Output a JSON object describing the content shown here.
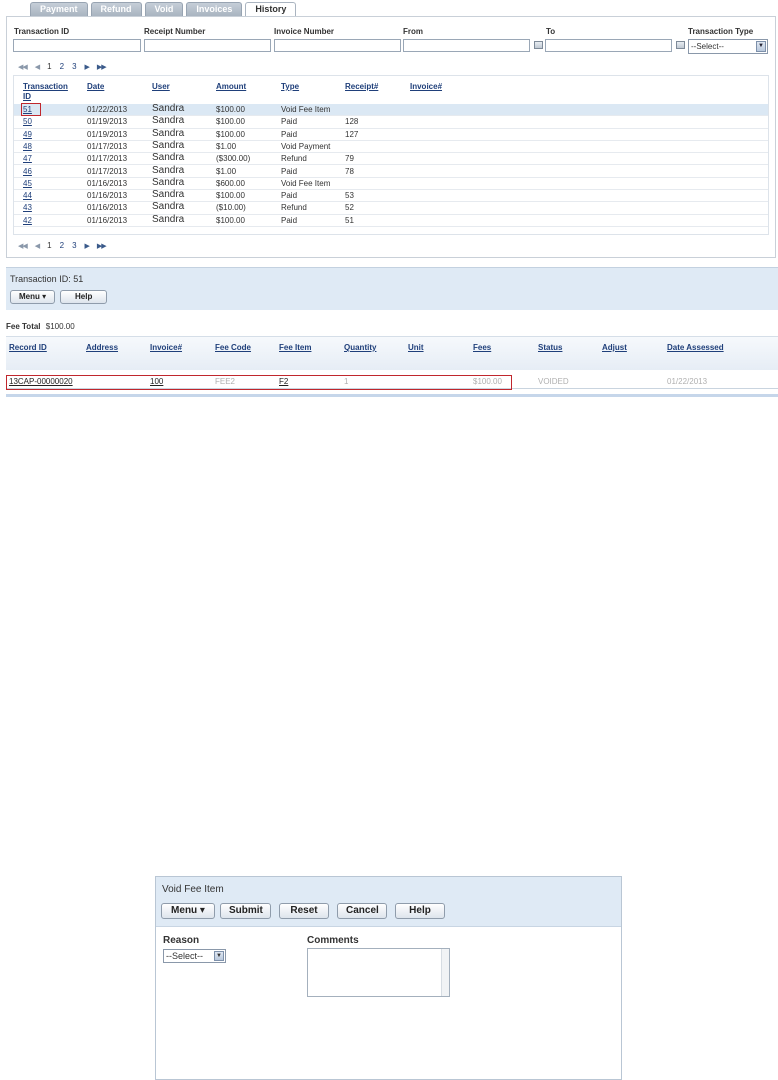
{
  "tabs": [
    {
      "label": "Payment"
    },
    {
      "label": "Refund"
    },
    {
      "label": "Void"
    },
    {
      "label": "Invoices"
    },
    {
      "label": "History",
      "active": true
    }
  ],
  "filters": {
    "transaction_id": "Transaction ID",
    "receipt_number": "Receipt Number",
    "invoice_number": "Invoice Number",
    "from": "From",
    "to": "To",
    "transaction_type": "Transaction Type",
    "transaction_type_value": "--Select--"
  },
  "pager": {
    "pages": [
      "1",
      "2",
      "3"
    ],
    "current": "1",
    "first": "◀◀",
    "prev": "◀",
    "next": "▶",
    "last": "▶▶"
  },
  "history_table": {
    "headers": {
      "id_line1": "Transaction",
      "id_line2": "ID",
      "date": "Date",
      "user": "User",
      "amount": "Amount",
      "type": "Type",
      "receipt": "Receipt#",
      "invoice": "Invoice#"
    },
    "rows": [
      {
        "id": "51",
        "date": "01/22/2013",
        "user": "Sandra",
        "amount": "$100.00",
        "type": "Void Fee Item",
        "receipt": ""
      },
      {
        "id": "50",
        "date": "01/19/2013",
        "user": "Sandra",
        "amount": "$100.00",
        "type": "Paid",
        "receipt": "128"
      },
      {
        "id": "49",
        "date": "01/19/2013",
        "user": "Sandra",
        "amount": "$100.00",
        "type": "Paid",
        "receipt": "127"
      },
      {
        "id": "48",
        "date": "01/17/2013",
        "user": "Sandra",
        "amount": "$1.00",
        "type": "Void Payment",
        "receipt": ""
      },
      {
        "id": "47",
        "date": "01/17/2013",
        "user": "Sandra",
        "amount": "($300.00)",
        "type": "Refund",
        "receipt": "79"
      },
      {
        "id": "46",
        "date": "01/17/2013",
        "user": "Sandra",
        "amount": "$1.00",
        "type": "Paid",
        "receipt": "78"
      },
      {
        "id": "45",
        "date": "01/16/2013",
        "user": "Sandra",
        "amount": "$600.00",
        "type": "Void Fee Item",
        "receipt": ""
      },
      {
        "id": "44",
        "date": "01/16/2013",
        "user": "Sandra",
        "amount": "$100.00",
        "type": "Paid",
        "receipt": "53"
      },
      {
        "id": "43",
        "date": "01/16/2013",
        "user": "Sandra",
        "amount": "($10.00)",
        "type": "Refund",
        "receipt": "52"
      },
      {
        "id": "42",
        "date": "01/16/2013",
        "user": "Sandra",
        "amount": "$100.00",
        "type": "Paid",
        "receipt": "51"
      }
    ]
  },
  "transaction_detail": {
    "title": "Transaction ID: 51",
    "menu_label": "Menu ▾",
    "help_label": "Help",
    "fee_total_label": "Fee Total",
    "fee_total_value": "$100.00"
  },
  "fee_table": {
    "headers": {
      "record_id": "Record ID",
      "address": "Address",
      "invoice": "Invoice#",
      "fee_code": "Fee Code",
      "fee_item": "Fee Item",
      "quantity": "Quantity",
      "unit": "Unit",
      "fees": "Fees",
      "status": "Status",
      "adjust": "Adjust",
      "date_assessed": "Date Assessed"
    },
    "row": {
      "record_id": "13CAP-00000020",
      "address": "",
      "invoice": "100",
      "fee_code": "FEE2",
      "fee_item": "F2",
      "quantity": "1",
      "unit": "",
      "fees": "$100.00",
      "status": "VOIDED",
      "adjust": "",
      "date_assessed": "01/22/2013"
    }
  },
  "void_dialog": {
    "title": "Void Fee Item",
    "menu_label": "Menu ▾",
    "submit_label": "Submit",
    "reset_label": "Reset",
    "cancel_label": "Cancel",
    "help_label": "Help",
    "reason_label": "Reason",
    "reason_value": "--Select--",
    "comments_label": "Comments",
    "comments_value": ""
  },
  "colors": {
    "link": "#1f3f7a",
    "highlight_box": "#c0272d",
    "selected_row": "#dbe8f4",
    "header_bar": "#dfeaf5"
  }
}
